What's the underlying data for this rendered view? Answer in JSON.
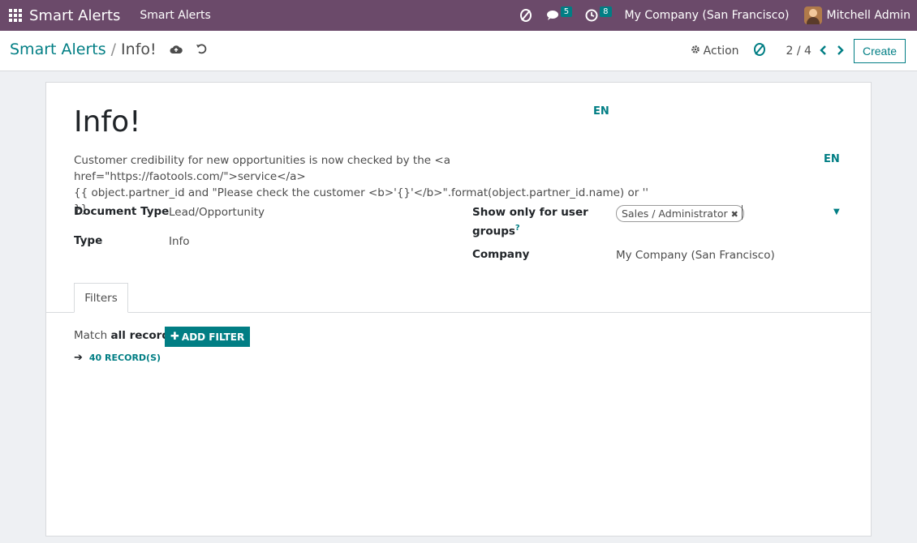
{
  "navbar": {
    "brand": "Smart Alerts",
    "menu_item": "Smart Alerts",
    "messages_count": "5",
    "activities_count": "8",
    "company": "My Company (San Francisco)",
    "user": "Mitchell Admin"
  },
  "control_panel": {
    "breadcrumb_parent": "Smart Alerts",
    "breadcrumb_separator": "/",
    "breadcrumb_current": "Info!",
    "action_label": "Action",
    "pager": "2 / 4",
    "create_label": "Create"
  },
  "form": {
    "title": "Info!",
    "title_lang": "EN",
    "message_lines": [
      "Customer credibility for new opportunities is now checked by the <a href=\"https://faotools.com/\">service</a>",
      "{{ object.partner_id and \"Please check the customer <b>'{}'</b>\".format(object.partner_id.name) or '' }}"
    ],
    "message_lang": "EN",
    "document_type_label": "Document Type",
    "document_type_value": "Lead/Opportunity",
    "type_label": "Type",
    "type_value": "Info",
    "groups_label_line1": "Show only for user",
    "groups_label_line2": "groups",
    "groups_help": "?",
    "groups_tag": "Sales / Administrator",
    "company_label": "Company",
    "company_value": "My Company (San Francisco)"
  },
  "tabs": [
    {
      "label": "Filters",
      "active": true
    }
  ],
  "filters": {
    "match_prefix": "Match",
    "match_mode": "all records",
    "add_filter_label": "ADD FILTER",
    "records_label": "40 RECORD(S)"
  },
  "colors": {
    "navbar": "#6b4a6a",
    "accent": "#017e84"
  }
}
